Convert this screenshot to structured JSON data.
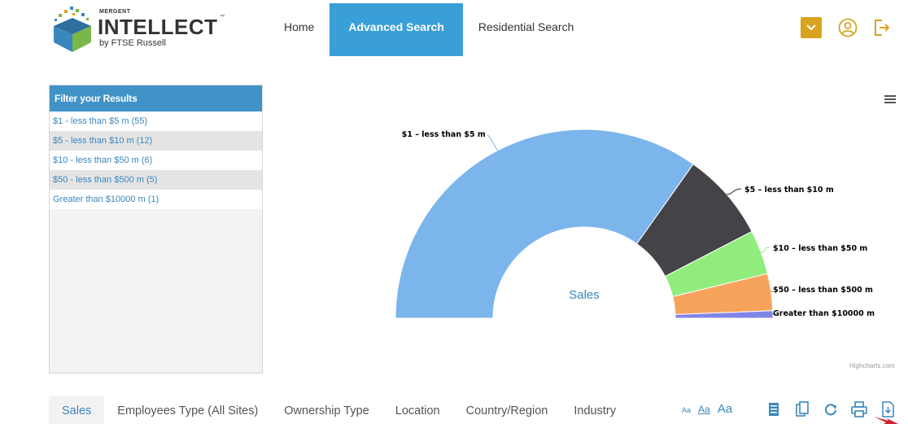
{
  "header": {
    "logo_small": "MERGENT",
    "logo_big": "INTELLECT",
    "logo_tm": "™",
    "logo_by": "by FTSE Russell",
    "nav": [
      {
        "label": "Home"
      },
      {
        "label": "Advanced Search"
      },
      {
        "label": "Residential Search"
      }
    ],
    "icons": [
      "mail-dropdown-icon",
      "user-icon",
      "logout-icon"
    ],
    "accent_color": "#3a9fd8",
    "mail_color": "#d9a320"
  },
  "filter": {
    "title": "Filter your Results",
    "items": [
      {
        "label": "$1 - less than $5 m (55)"
      },
      {
        "label": "$5 - less than $10 m (12)"
      },
      {
        "label": "$10 - less than $50 m (6)"
      },
      {
        "label": "$50 - less than $500 m (5)"
      },
      {
        "label": "Greater than $10000 m (1)"
      }
    ]
  },
  "chart_data": {
    "type": "pie",
    "variant": "semi-circle donut",
    "center_label": "Sales",
    "slices": [
      {
        "label": "$1 – less than $5 m",
        "value": 55,
        "color": "#7cb5ec"
      },
      {
        "label": "$5 – less than $10 m",
        "value": 12,
        "color": "#434348"
      },
      {
        "label": "$10 – less than $50 m",
        "value": 6,
        "color": "#90ed7d"
      },
      {
        "label": "$50 – less than $500 m",
        "value": 5,
        "color": "#f7a35c"
      },
      {
        "label": "Greater than $10000 m",
        "value": 1,
        "color": "#8085e9"
      }
    ],
    "credits": "Highcharts.com"
  },
  "tabs": [
    {
      "label": "Sales"
    },
    {
      "label": "Employees Type (All Sites)"
    },
    {
      "label": "Ownership Type"
    },
    {
      "label": "Location"
    },
    {
      "label": "Country/Region"
    },
    {
      "label": "Industry"
    }
  ],
  "font_sizes": [
    "Aa",
    "Aa",
    "Aa"
  ],
  "tools": [
    "bookmark-icon",
    "copy-icon",
    "refresh-icon",
    "print-icon",
    "download-icon"
  ]
}
